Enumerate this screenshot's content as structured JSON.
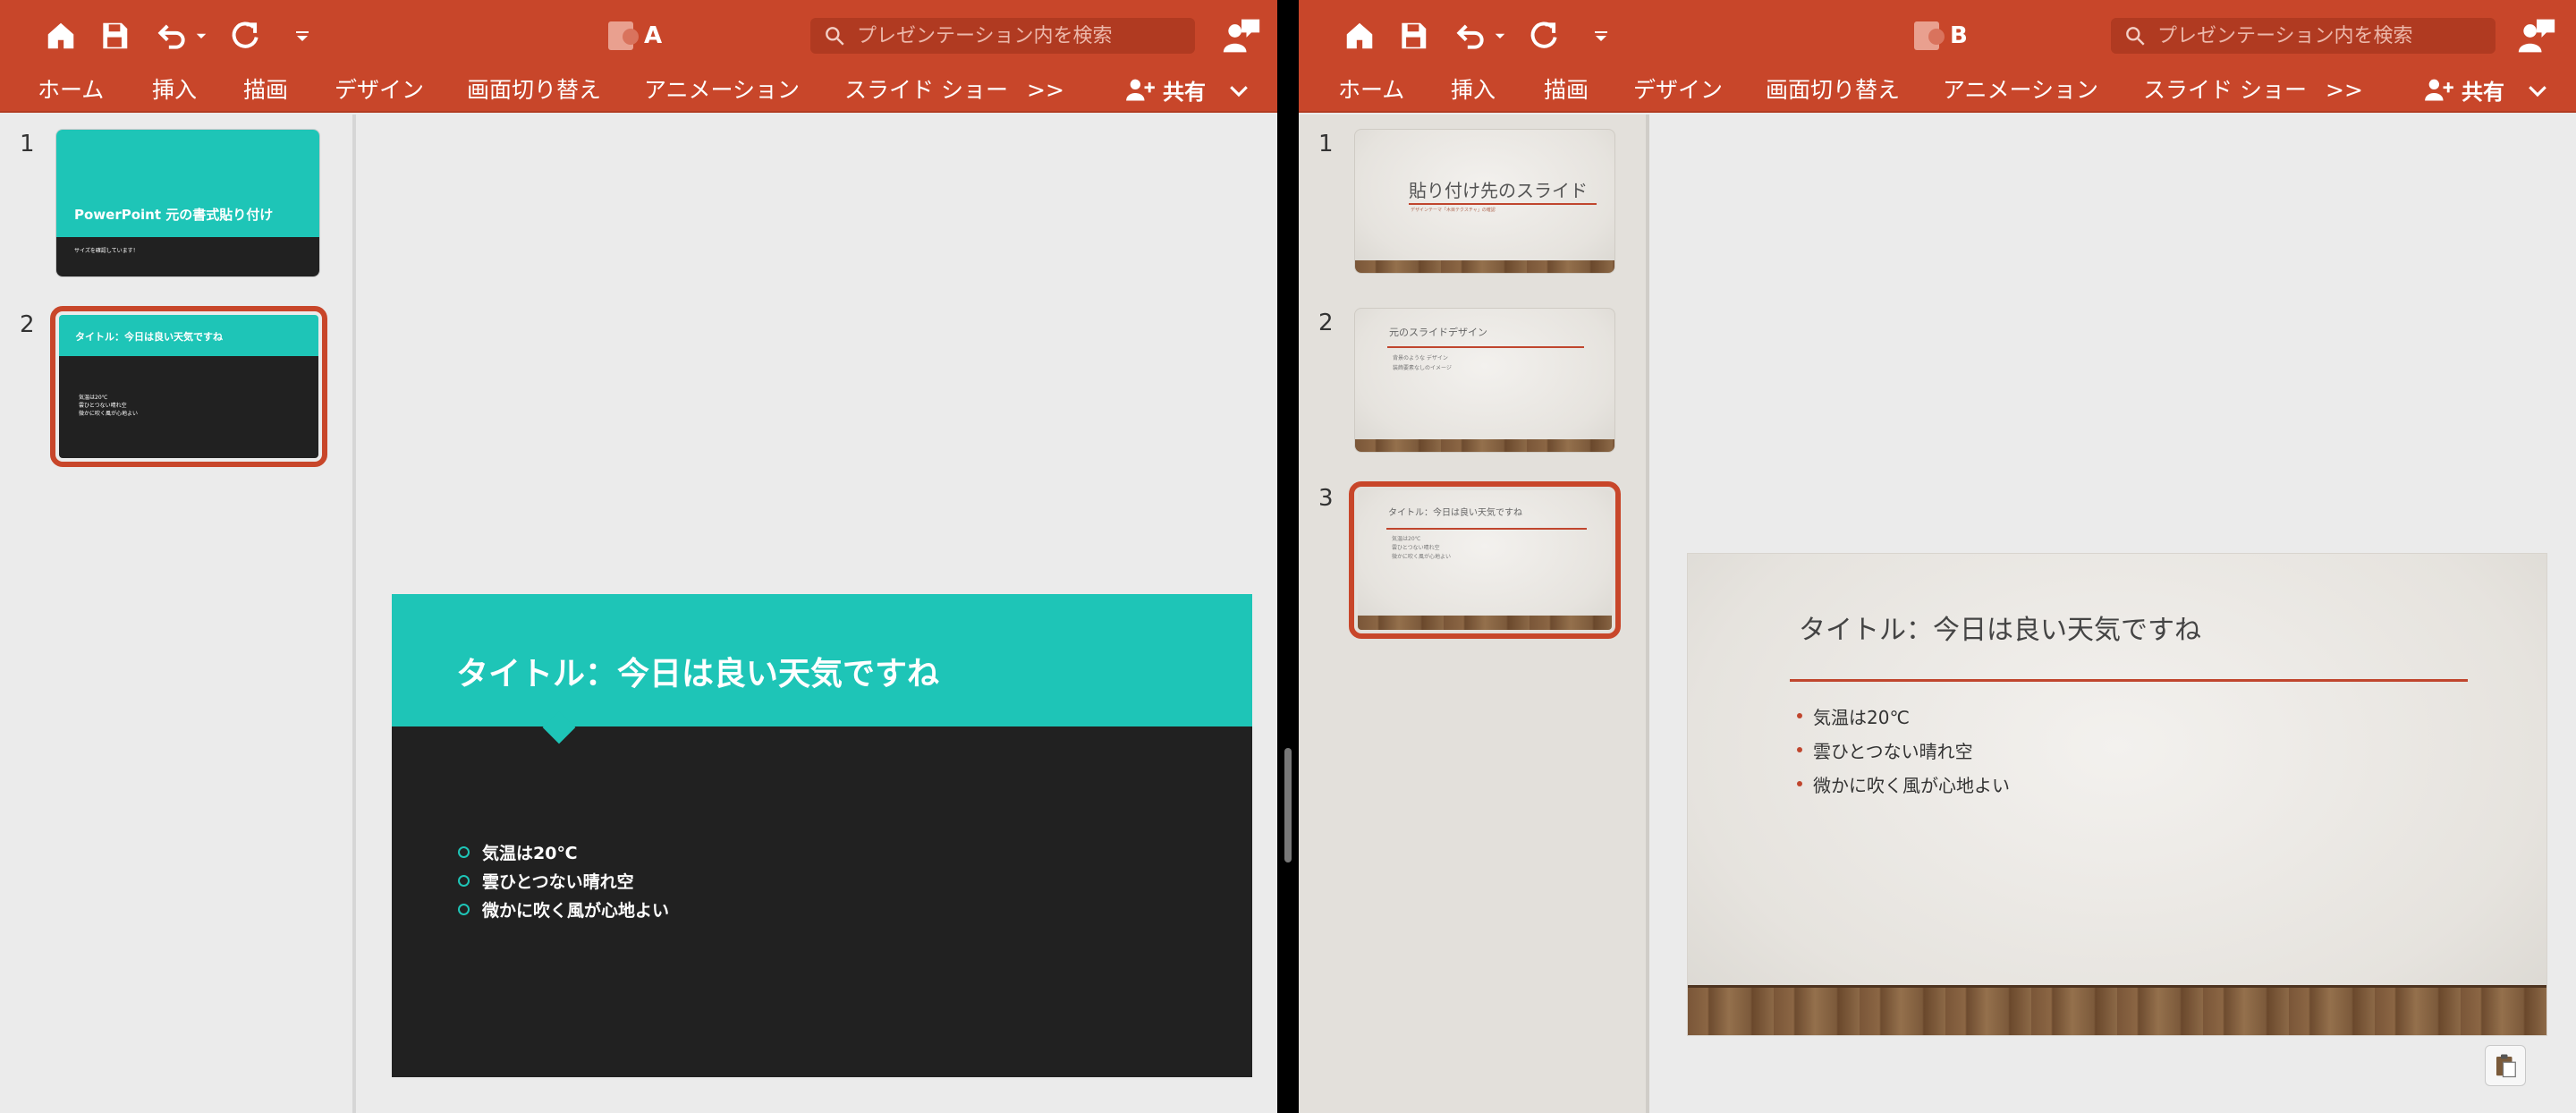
{
  "panes": [
    {
      "doc_title": "A",
      "search_placeholder": "プレゼンテーション内を検索",
      "tabs": [
        "ホーム",
        "挿入",
        "描画",
        "デザイン",
        "画面切り替え",
        "アニメーション",
        "スライド ショー",
        ">>"
      ],
      "share_label": "共有",
      "thumbnails": [
        {
          "num": "1",
          "title": "PowerPoint 元の書式貼り付け",
          "subtitle": "サイズを確認しています！"
        },
        {
          "num": "2",
          "title": "タイトル：今日は良い天気ですね",
          "bullets": [
            "気温は20℃",
            "雲ひとつない晴れ空",
            "微かに吹く風が心地よい"
          ]
        }
      ],
      "main_slide": {
        "title": "タイトル：今日は良い天気ですね",
        "bullets": [
          "気温は20℃",
          "雲ひとつない晴れ空",
          "微かに吹く風が心地よい"
        ]
      }
    },
    {
      "doc_title": "B",
      "search_placeholder": "プレゼンテーション内を検索",
      "tabs": [
        "ホーム",
        "挿入",
        "描画",
        "デザイン",
        "画面切り替え",
        "アニメーション",
        "スライド ショー",
        ">>"
      ],
      "share_label": "共有",
      "thumbnails": [
        {
          "num": "1",
          "title": "貼り付け先のスライド",
          "subtitle": "デザインテーマ「木目テクスチャ」の確認"
        },
        {
          "num": "2",
          "title": "元のスライドデザイン",
          "bullets": [
            "背景のような デザイン",
            "装飾要素なしのイメージ"
          ]
        },
        {
          "num": "3",
          "title": "タイトル：今日は良い天気ですね",
          "bullets": [
            "気温は20℃",
            "雲ひとつない晴れ空",
            "微かに吹く風が心地よい"
          ]
        }
      ],
      "main_slide": {
        "title": "タイトル：今日は良い天気ですね",
        "bullets": [
          "気温は20℃",
          "雲ひとつない晴れ空",
          "微かに吹く風が心地よい"
        ]
      }
    }
  ],
  "colors": {
    "ribbon": "#c8462a",
    "teal": "#1ec5b7",
    "dark_slide": "#212121",
    "accent_line": "#c0462e"
  }
}
